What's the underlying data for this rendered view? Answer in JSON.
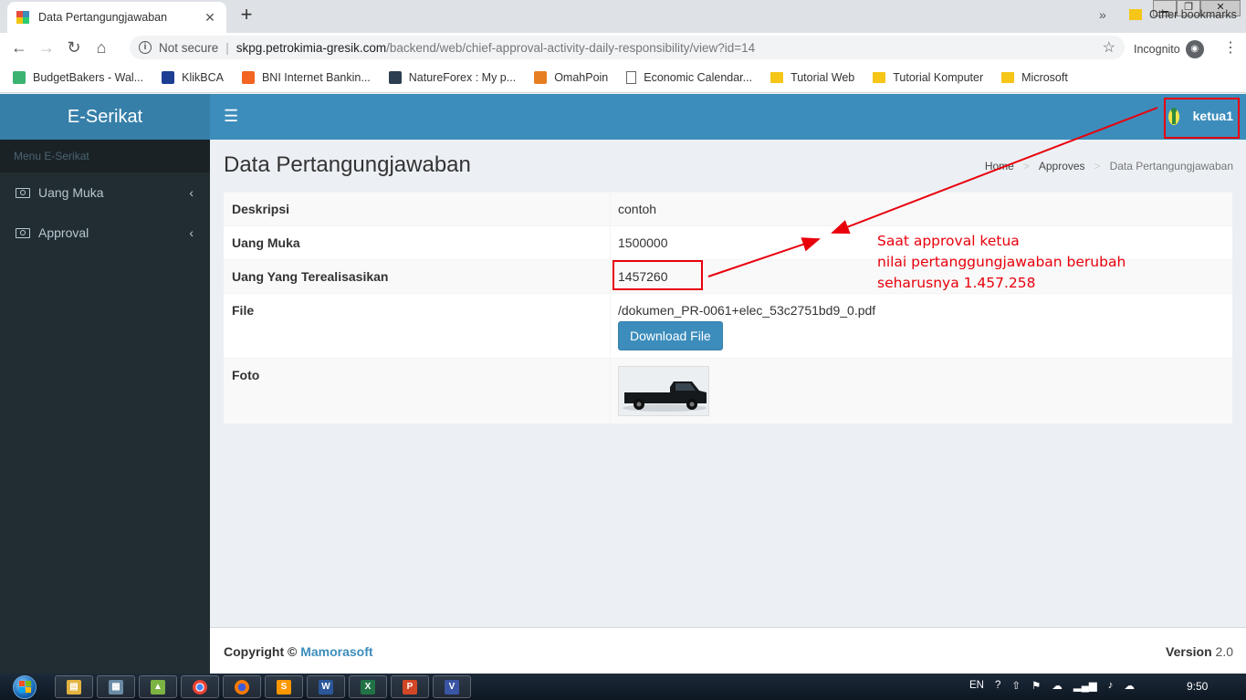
{
  "browser": {
    "tab_title": "Data Pertangungjawaban",
    "not_secure": "Not secure",
    "url_host": "skpg.petrokimia-gresik.com",
    "url_path": "/backend/web/chief-approval-activity-daily-responsibility/view?id=14",
    "incognito": "Incognito",
    "bookmarks": [
      {
        "label": "BudgetBakers - Wal...",
        "icon": "budgetbakers-icon",
        "color": "#3cb371"
      },
      {
        "label": "KlikBCA",
        "icon": "klikbca-icon",
        "color": "#1c3f94"
      },
      {
        "label": "BNI Internet Bankin...",
        "icon": "bni-icon",
        "color": "#f26522"
      },
      {
        "label": "NatureForex : My p...",
        "icon": "natureforex-icon",
        "color": "#2c3e50"
      },
      {
        "label": "OmahPoin",
        "icon": "omahpoin-icon",
        "color": "#e67e22"
      },
      {
        "label": "Economic Calendar...",
        "icon": "page-icon",
        "color": ""
      },
      {
        "label": "Tutorial Web",
        "icon": "folder-icon",
        "color": "#f5c518"
      },
      {
        "label": "Tutorial Komputer",
        "icon": "folder-icon",
        "color": "#f5c518"
      },
      {
        "label": "Microsoft",
        "icon": "folder-icon",
        "color": "#f5c518"
      }
    ],
    "bookmarks_more": "»",
    "other_bookmarks": "Other bookmarks"
  },
  "app": {
    "brand": "E-Serikat",
    "user": "ketua1",
    "sidebar": {
      "header": "Menu E-Serikat",
      "items": [
        {
          "label": "Uang Muka"
        },
        {
          "label": "Approval"
        }
      ]
    },
    "page_title": "Data Pertangungjawaban",
    "breadcrumb": [
      "Home",
      "Approves",
      "Data Pertangungjawaban"
    ],
    "detail": {
      "rows": [
        {
          "label": "Deskripsi",
          "value": "contoh"
        },
        {
          "label": "Uang Muka",
          "value": "1500000"
        },
        {
          "label": "Uang Yang Terealisasikan",
          "value": "1457260"
        },
        {
          "label": "File",
          "value": "/dokumen_PR-0061+elec_53c2751bd9_0.pdf"
        },
        {
          "label": "Foto",
          "value": ""
        }
      ],
      "download_label": "Download File"
    },
    "footer": {
      "copyright": "Copyright ©",
      "company": "Mamorasoft",
      "version_label": "Version",
      "version": "2.0"
    }
  },
  "annotation": {
    "note": "Saat approval ketua\nnilai pertanggungjawaban berubah\nseharusnya 1.457.258",
    "color": "#e8000b"
  },
  "taskbar": {
    "lang": "EN",
    "time": "9:50",
    "apps": [
      "explorer",
      "calculator",
      "photos",
      "chrome",
      "firefox",
      "sublime",
      "word",
      "excel",
      "powerpoint",
      "visio"
    ]
  },
  "colors": {
    "header": "#3c8dbc",
    "logo_bg": "#367fa9",
    "sidebar": "#222d32"
  }
}
